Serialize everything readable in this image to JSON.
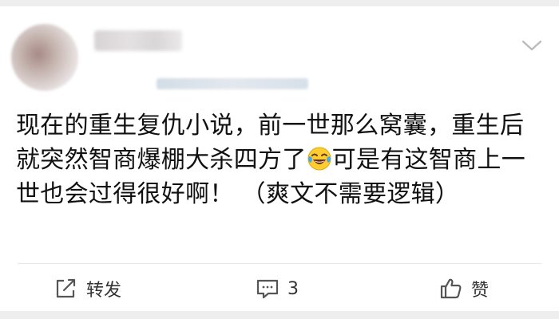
{
  "post": {
    "text_before_emoji": "现在的重生复仇小说，前一世那么窝囊，重生后就突然智商爆棚大杀四方了",
    "emoji": "laughing-crying-emoji",
    "text_after_emoji": "可是有这智商上一世也会过得很好啊！ （爽文不需要逻辑）"
  },
  "actions": {
    "repost_label": "转发",
    "comment_count": "3",
    "like_label": "赞"
  },
  "icons": {
    "repost": "share-icon",
    "comment": "comment-icon",
    "like": "thumbs-up-icon",
    "more": "chevron-down-icon"
  },
  "colors": {
    "text": "#111111",
    "action_text": "#333333",
    "background": "#eeeeee",
    "card": "#ffffff"
  }
}
